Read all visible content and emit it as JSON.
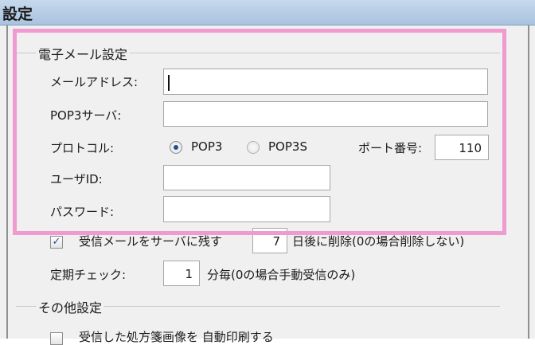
{
  "window": {
    "title": "設定"
  },
  "email_group": {
    "title": "電子メール設定",
    "address_label": "メールアドレス:",
    "address_value": "",
    "pop3_server_label": "POP3サーバ:",
    "pop3_server_value": "",
    "protocol_label": "プロトコル:",
    "protocol_options": [
      "POP3",
      "POP3S"
    ],
    "protocol_selected": "POP3",
    "port_label": "ポート番号:",
    "port_value": "110",
    "user_id_label": "ユーザID:",
    "user_id_value": "",
    "password_label": "パスワード:",
    "password_value": "",
    "keep_on_server_label": "受信メールをサーバに残す",
    "keep_on_server_checked": true,
    "keep_days_value": "7",
    "keep_days_suffix": "日後に削除(0の場合削除しない)",
    "periodic_check_label": "定期チェック:",
    "periodic_check_value": "1",
    "periodic_check_suffix": "分毎(0の場合手動受信のみ)"
  },
  "other_group": {
    "title": "その他設定",
    "auto_print_label": "受信した処方箋画像を 自動印刷する",
    "auto_print_checked": false
  },
  "colors": {
    "highlight": "#f09bcf",
    "titlebar": "#b8cde6"
  }
}
